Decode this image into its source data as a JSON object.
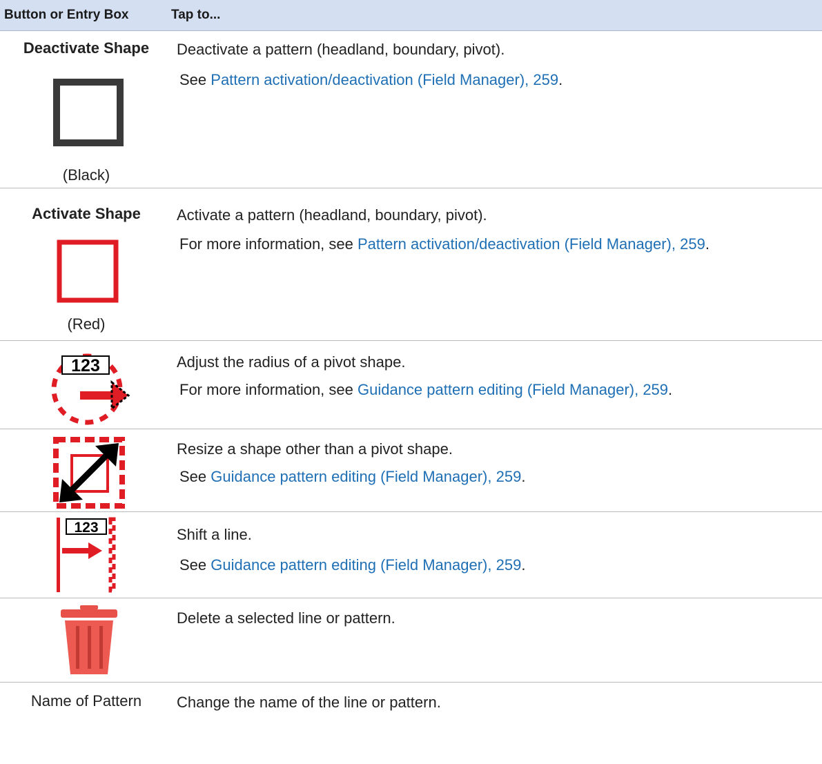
{
  "header": {
    "col1": "Button or Entry Box",
    "col2": "Tap to..."
  },
  "rows": [
    {
      "label": "Deactivate Shape",
      "icon": "black-square-outline-icon",
      "caption": "(Black)",
      "text1": "Deactivate a pattern (headland, boundary, pivot).",
      "text2_prefix": "See ",
      "link": "Pattern activation/deactivation (Field Manager), 259",
      "text2_suffix": "."
    },
    {
      "label": "Activate Shape",
      "icon": "red-square-outline-icon",
      "caption": "(Red)",
      "text1": "Activate a pattern (headland, boundary, pivot).",
      "text2_prefix": "For more information, see ",
      "link": "Pattern activation/deactivation (Field Manager), 259",
      "text2_suffix": "."
    },
    {
      "icon": "pivot-radius-icon",
      "icon_text": "123",
      "text1": "Adjust the radius of a pivot shape.",
      "text2_prefix": "For more information, see ",
      "link": "Guidance pattern editing (Field Manager), 259",
      "text2_suffix": "."
    },
    {
      "icon": "resize-shape-icon",
      "text1": "Resize a shape other than a pivot shape.",
      "text2_prefix": "See ",
      "link": "Guidance pattern editing (Field Manager), 259",
      "text2_suffix": "."
    },
    {
      "icon": "shift-line-icon",
      "icon_text": "123",
      "text1": "Shift a line.",
      "text2_prefix": "See ",
      "link": "Guidance pattern editing (Field Manager), 259",
      "text2_suffix": "."
    },
    {
      "icon": "trash-icon",
      "text1": "Delete a selected line or pattern."
    },
    {
      "label": "Name of Pattern",
      "text1": "Change the name of the line or pattern."
    }
  ],
  "colors": {
    "header_bg": "#d4e0f2",
    "link": "#1f6fb5",
    "red": "#e01c24",
    "black": "#3a3a3a"
  }
}
